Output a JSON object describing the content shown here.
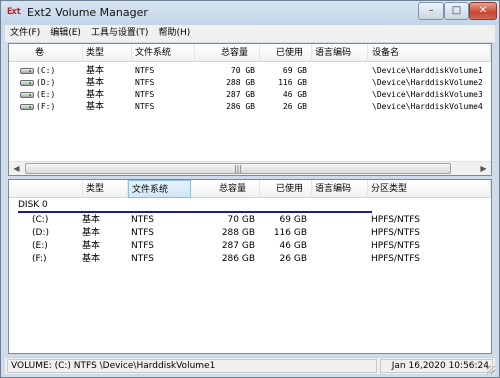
{
  "window": {
    "icon_text": "Ext",
    "title": "Ext2 Volume Manager",
    "min_glyph": "–",
    "max_glyph": "□",
    "close_glyph": "✕"
  },
  "menu": [
    "文件(F)",
    "编辑(E)",
    "工具与设置(T)",
    "帮助(H)"
  ],
  "volumes": {
    "headers": {
      "volume": "卷",
      "type": "类型",
      "fs": "文件系统",
      "total": "总容量",
      "used": "已使用",
      "codepage": "语言编码",
      "device": "设备名"
    },
    "rows": [
      {
        "volume": "(C:)",
        "type": "基本",
        "fs": "NTFS",
        "total": "70 GB",
        "used": "69 GB",
        "codepage": "",
        "device": "\\Device\\HarddiskVolume1"
      },
      {
        "volume": "(D:)",
        "type": "基本",
        "fs": "NTFS",
        "total": "288 GB",
        "used": "116 GB",
        "codepage": "",
        "device": "\\Device\\HarddiskVolume2"
      },
      {
        "volume": "(E:)",
        "type": "基本",
        "fs": "NTFS",
        "total": "287 GB",
        "used": "46 GB",
        "codepage": "",
        "device": "\\Device\\HarddiskVolume3"
      },
      {
        "volume": "(F:)",
        "type": "基本",
        "fs": "NTFS",
        "total": "286 GB",
        "used": "26 GB",
        "codepage": "",
        "device": "\\Device\\HarddiskVolume4"
      }
    ],
    "scroll_left": "◀",
    "scroll_right": "▶",
    "scroll_grip": "|||"
  },
  "disks": {
    "headers": {
      "name": "",
      "type": "类型",
      "fs": "文件系统",
      "total": "总容量",
      "used": "已使用",
      "codepage": "语言编码",
      "ptype": "分区类型"
    },
    "disk_label": "DISK 0",
    "rows": [
      {
        "name": "(C:)",
        "type": "基本",
        "fs": "NTFS",
        "total": "70 GB",
        "used": "69 GB",
        "codepage": "",
        "ptype": "HPFS/NTFS"
      },
      {
        "name": "(D:)",
        "type": "基本",
        "fs": "NTFS",
        "total": "288 GB",
        "used": "116 GB",
        "codepage": "",
        "ptype": "HPFS/NTFS"
      },
      {
        "name": "(E:)",
        "type": "基本",
        "fs": "NTFS",
        "total": "287 GB",
        "used": "46 GB",
        "codepage": "",
        "ptype": "HPFS/NTFS"
      },
      {
        "name": "(F:)",
        "type": "基本",
        "fs": "NTFS",
        "total": "286 GB",
        "used": "26 GB",
        "codepage": "",
        "ptype": "HPFS/NTFS"
      }
    ]
  },
  "status": {
    "left": "VOLUME: (C:) NTFS \\Device\\HarddiskVolume1",
    "right": "Jan 16,2020 10:56:24"
  }
}
